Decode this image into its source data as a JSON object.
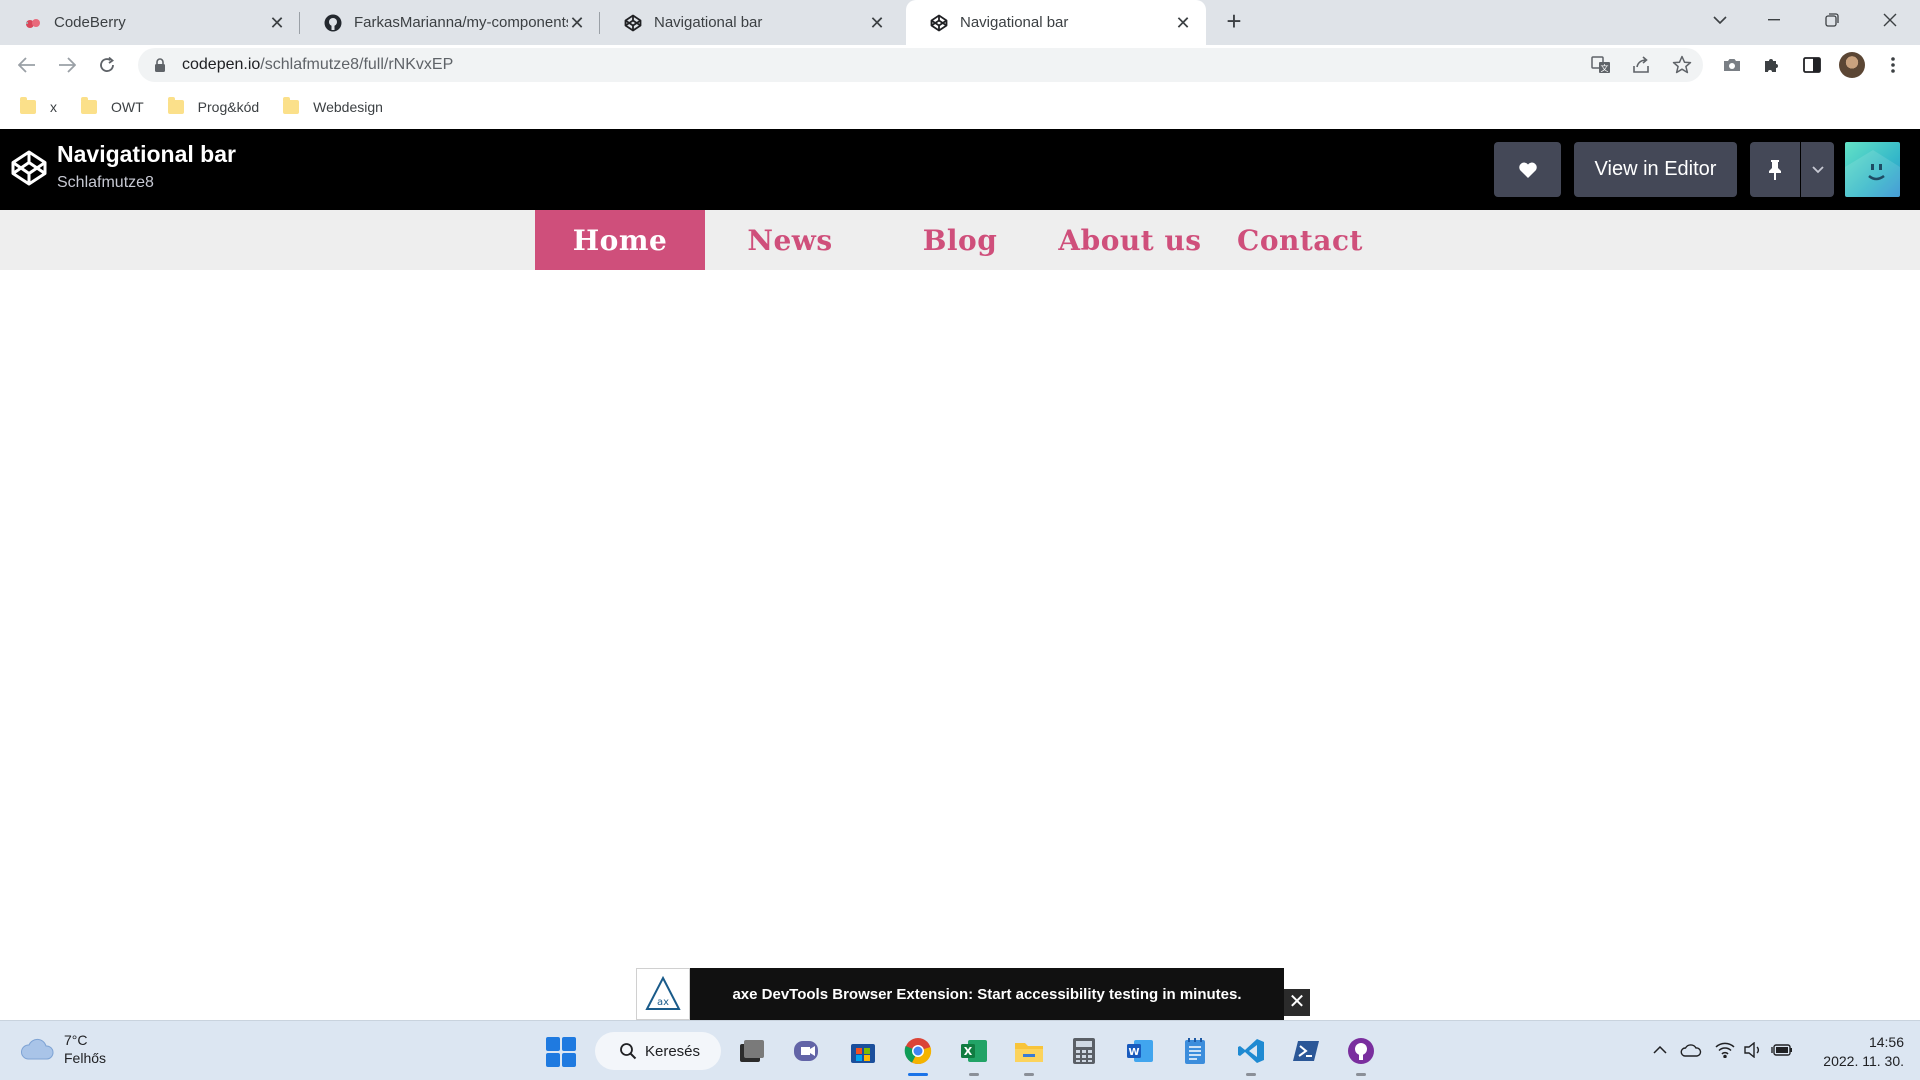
{
  "browser": {
    "tabs": [
      {
        "title": "CodeBerry",
        "favicon": "codeberry-icon",
        "active": false
      },
      {
        "title": "FarkasMarianna/my-components",
        "favicon": "github-icon",
        "active": false
      },
      {
        "title": "Navigational bar",
        "favicon": "codepen-icon",
        "active": false
      },
      {
        "title": "Navigational bar",
        "favicon": "codepen-icon",
        "active": true
      }
    ],
    "url_host": "codepen.io",
    "url_path": "/schlafmutze8/full/rNKvxEP",
    "bookmarks": [
      {
        "label": "x"
      },
      {
        "label": "OWT"
      },
      {
        "label": "Prog&kód"
      },
      {
        "label": "Webdesign"
      }
    ]
  },
  "codepen": {
    "title": "Navigational bar",
    "author": "Schlafmutze8",
    "view_in_editor": "View in Editor",
    "colors": {
      "header_bg": "#000000",
      "button_bg": "#444857"
    }
  },
  "pen": {
    "nav_items": [
      {
        "label": "Home",
        "active": true
      },
      {
        "label": "News",
        "active": false
      },
      {
        "label": "Blog",
        "active": false
      },
      {
        "label": "About us",
        "active": false
      },
      {
        "label": "Contact",
        "active": false
      }
    ],
    "colors": {
      "accent": "#cf4f7b",
      "nav_bg": "#eeeeee"
    }
  },
  "axe_banner": {
    "message": "axe DevTools Browser Extension: Start accessibility testing in minutes."
  },
  "taskbar": {
    "weather_temp": "7°C",
    "weather_desc": "Felhős",
    "search_label": "Keresés",
    "time": "14:56",
    "date": "2022. 11. 30.",
    "apps": [
      "file-explorer-icon",
      "teams-icon",
      "store-icon",
      "chrome-icon",
      "excel-icon",
      "folder-icon",
      "calculator-icon",
      "word-icon",
      "notepad-icon",
      "vscode-icon",
      "powershell-icon",
      "github-desktop-icon"
    ]
  }
}
